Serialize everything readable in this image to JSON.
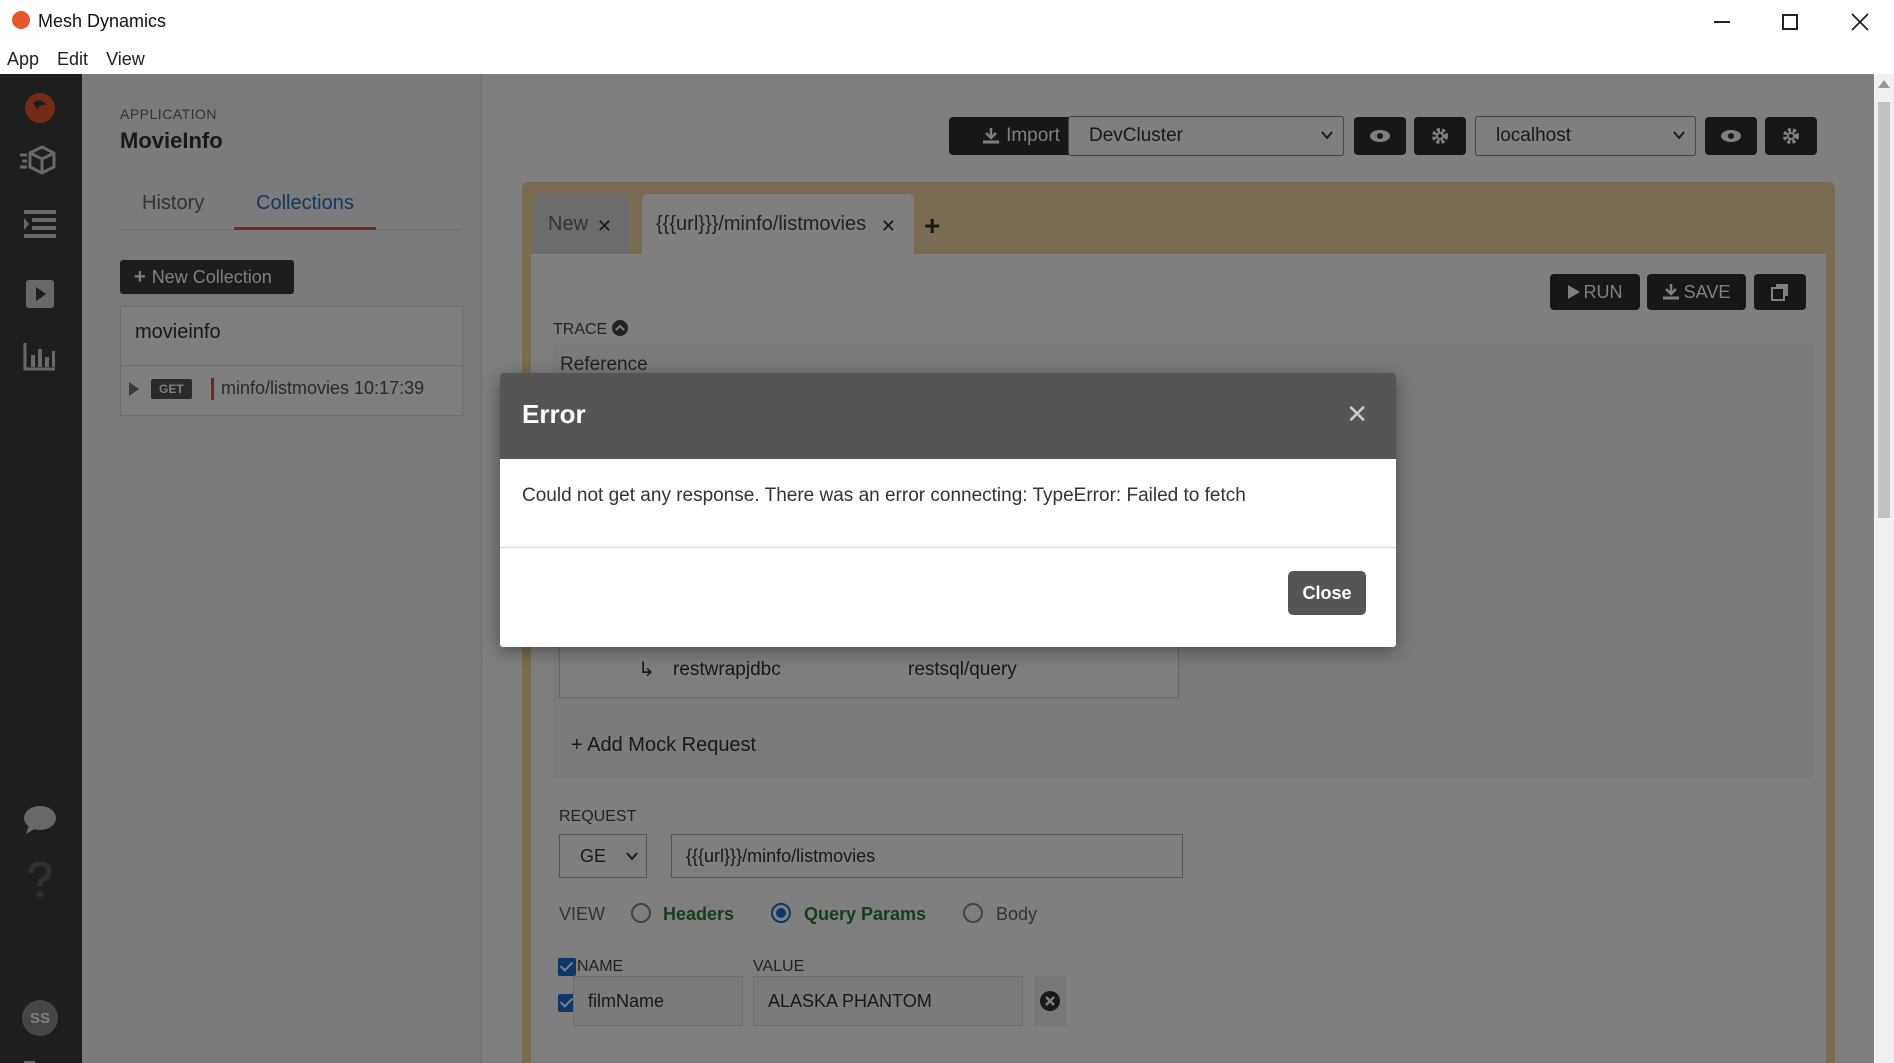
{
  "window": {
    "title": "Mesh Dynamics",
    "menu": [
      "App",
      "Edit",
      "View"
    ]
  },
  "sidebar": {
    "caption": "APPLICATION",
    "app_name": "MovieInfo",
    "tabs": [
      "History",
      "Collections"
    ],
    "active_tab": "Collections",
    "new_collection_label": "New Collection",
    "collection": {
      "name": "movieinfo",
      "items": [
        {
          "method": "GET",
          "label": "minfo/listmovies 10:17:39"
        }
      ]
    },
    "avatar_initials": "SS"
  },
  "toolbar": {
    "import_label": "Import",
    "cluster": "DevCluster",
    "environment": "localhost"
  },
  "tabs": [
    {
      "label": "New",
      "active": false
    },
    {
      "label": "{{{url}}}/minfo/listmovies",
      "active": true
    }
  ],
  "request_panel": {
    "run_label": "RUN",
    "save_label": "SAVE",
    "trace_label": "TRACE",
    "trace_reference": "Reference",
    "mock": {
      "service": "restwrapjdbc",
      "path": "restsql/query"
    },
    "add_mock_label": "Add Mock Request",
    "request_label": "REQUEST",
    "method": "GE",
    "url": "{{{url}}}/minfo/listmovies",
    "view_label": "VIEW",
    "view_options": [
      "Headers",
      "Query Params",
      "Body"
    ],
    "view_selected": "Query Params",
    "param_headers": {
      "name": "NAME",
      "value": "VALUE"
    },
    "params": [
      {
        "name": "filmName",
        "value": "ALASKA PHANTOM",
        "checked": true
      }
    ]
  },
  "dialog": {
    "title": "Error",
    "message": "Could not get any response. There was an error connecting: TypeError: Failed to fetch",
    "close_label": "Close"
  },
  "colors": {
    "accent": "#e8562a",
    "rail_bg": "#3d3d3d",
    "workspace_bg": "#f3d9a4",
    "link_blue": "#2a6fc0",
    "active_green": "#2e7d32"
  }
}
